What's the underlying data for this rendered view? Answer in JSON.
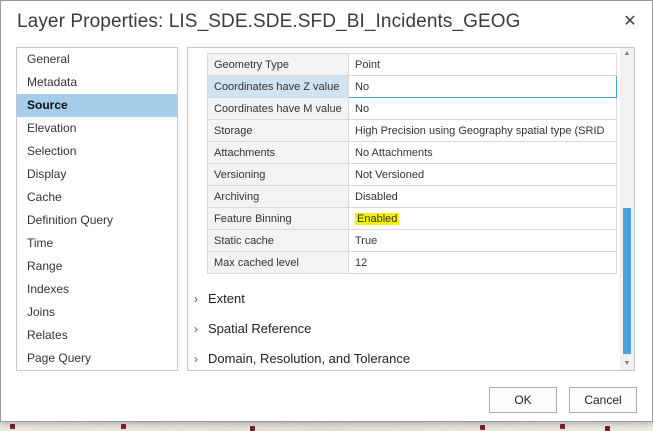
{
  "window": {
    "title": "Layer Properties: LIS_SDE.SDE.SFD_BI_Incidents_GEOG"
  },
  "nav": {
    "items": [
      {
        "label": "General"
      },
      {
        "label": "Metadata"
      },
      {
        "label": "Source"
      },
      {
        "label": "Elevation"
      },
      {
        "label": "Selection"
      },
      {
        "label": "Display"
      },
      {
        "label": "Cache"
      },
      {
        "label": "Definition Query"
      },
      {
        "label": "Time"
      },
      {
        "label": "Range"
      },
      {
        "label": "Indexes"
      },
      {
        "label": "Joins"
      },
      {
        "label": "Relates"
      },
      {
        "label": "Page Query"
      }
    ],
    "active": "Source"
  },
  "properties": [
    {
      "key": "Geometry Type",
      "value": "Point"
    },
    {
      "key": "Coordinates have Z value",
      "value": "No"
    },
    {
      "key": "Coordinates have M value",
      "value": "No"
    },
    {
      "key": "Storage",
      "value": "High Precision using Geography spatial type (SRID"
    },
    {
      "key": "Attachments",
      "value": "No Attachments"
    },
    {
      "key": "Versioning",
      "value": "Not Versioned"
    },
    {
      "key": "Archiving",
      "value": "Disabled"
    },
    {
      "key": "Feature Binning",
      "value": "Enabled"
    },
    {
      "key": "Static cache",
      "value": "True"
    },
    {
      "key": "Max cached level",
      "value": "12"
    }
  ],
  "sections": [
    {
      "label": "Extent"
    },
    {
      "label": "Spatial Reference"
    },
    {
      "label": "Domain, Resolution, and Tolerance"
    }
  ],
  "buttons": {
    "ok": "OK",
    "cancel": "Cancel"
  },
  "icons": {
    "close": "close-icon",
    "expand": "chevron-right-icon"
  },
  "colors": {
    "selection": "#a6cdea",
    "accent": "#4aa3df",
    "highlight": "#f6f200"
  }
}
